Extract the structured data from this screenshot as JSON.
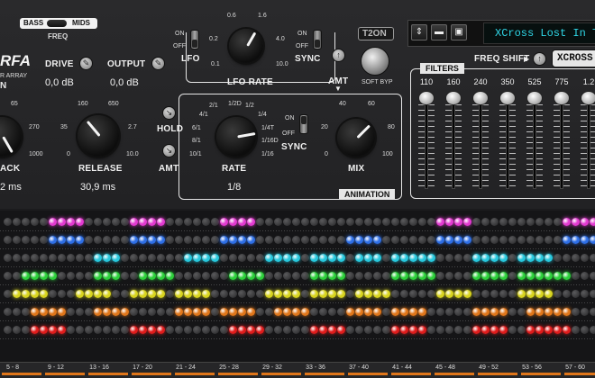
{
  "colors": {
    "magenta": "#e23ad0",
    "blue": "#2e6fe6",
    "cyan": "#27c7dc",
    "green": "#2ccf3a",
    "yellow": "#d8d41e",
    "orange": "#e0761a",
    "red": "#e01c1c",
    "off": "#3a3a3c",
    "display_text": "#2fd6e6",
    "step_marker": "#e0761a"
  },
  "header": {
    "bass_label": "BASS",
    "mids_label": "MIDS",
    "freq_label": "FREQ",
    "logo_text": "RFA",
    "logo_sub": "R ARRAY",
    "logo_sub2": "N"
  },
  "drive": {
    "label": "DRIVE",
    "value": "0,0 dB"
  },
  "output": {
    "label": "OUTPUT",
    "value": "0,0 dB"
  },
  "lfo": {
    "on_label": "ON",
    "off_label": "OFF",
    "lfo_label": "LFO",
    "ticks": [
      "0.6",
      "1.6",
      "0.2",
      "4.0",
      "0.1",
      "10.0"
    ],
    "rate_label": "LFO RATE",
    "sync_on": "ON",
    "sync_off": "OFF",
    "sync_label": "SYNC",
    "amt_label": "AMT"
  },
  "t2on": {
    "label": "T2ON",
    "soft_byp": "SOFT BYP"
  },
  "toolbar": {
    "updown_icon": "up-down-arrows-icon",
    "folder_icon": "folder-icon",
    "save_icon": "save-icon",
    "preset_name": "XCross Lost In T"
  },
  "freq_shift": {
    "label": "FREQ SHIFT",
    "arrow": "▶",
    "xcross_label": "XCROSS"
  },
  "filters": {
    "label": "FILTERS",
    "freqs": [
      "110",
      "160",
      "240",
      "350",
      "525",
      "775",
      "1.2"
    ],
    "levels": [
      0.95,
      0.95,
      0.95,
      0.95,
      0.95,
      0.95,
      0.95
    ]
  },
  "attack": {
    "label": "ACK",
    "value": "2 ms",
    "ticks": [
      "65",
      "270",
      "1000"
    ]
  },
  "release": {
    "label": "RELEASE",
    "value": "30,9 ms",
    "ticks": [
      "160",
      "650",
      "35",
      "2.7",
      "0",
      "10.0"
    ]
  },
  "hold": {
    "label": "HOLD",
    "amt_label": "AMT"
  },
  "rate": {
    "label": "RATE",
    "value": "1/8",
    "left_ticks": [
      "2/1",
      "4/1",
      "6/1",
      "8/1",
      "10/1"
    ],
    "right_ticks": [
      "1/2D",
      "1/2",
      "1/4",
      "1/4T",
      "1/16D",
      "1/16"
    ],
    "sync_on": "ON",
    "sync_off": "OFF",
    "sync_label": "SYNC"
  },
  "mix": {
    "label": "MIX",
    "ticks": [
      "40",
      "60",
      "20",
      "80",
      "0",
      "100"
    ]
  },
  "animation": {
    "label": "ANIMATION"
  },
  "steps": {
    "labels": [
      "5 - 8",
      "9 - 12",
      "13 - 16",
      "17 - 20",
      "21 - 24",
      "25 - 28",
      "29 - 32",
      "33 - 36",
      "37 - 40",
      "41 - 44",
      "45 - 48",
      "49 - 52",
      "53 - 56",
      "57 - 60"
    ]
  }
}
